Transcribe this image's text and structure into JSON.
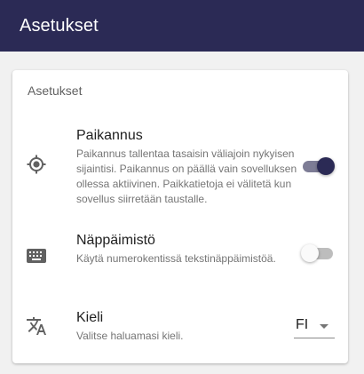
{
  "app_bar": {
    "title": "Asetukset"
  },
  "card": {
    "title": "Asetukset",
    "settings": [
      {
        "icon": "gps-location-icon",
        "title": "Paikannus",
        "description": "Paikannus tallentaa tasaisin väliajoin nykyisen sijaintisi. Paikannus on päällä vain sovelluksen ollessa aktiivinen. Paikkatietoja ei välitetä kun sovellus siirretään taustalle.",
        "enabled": true
      },
      {
        "icon": "keyboard-icon",
        "title": "Näppäimistö",
        "description": "Käytä numerokentissä tekstinäppäimistöä.",
        "enabled": false
      },
      {
        "icon": "translate-icon",
        "title": "Kieli",
        "description": "Valitse haluamasi kieli.",
        "selected_language": "FI"
      }
    ]
  },
  "colors": {
    "app_bar": "#2b2a55",
    "switch_on_thumb": "#2b2a55",
    "switch_on_track": "#7d7c95"
  }
}
